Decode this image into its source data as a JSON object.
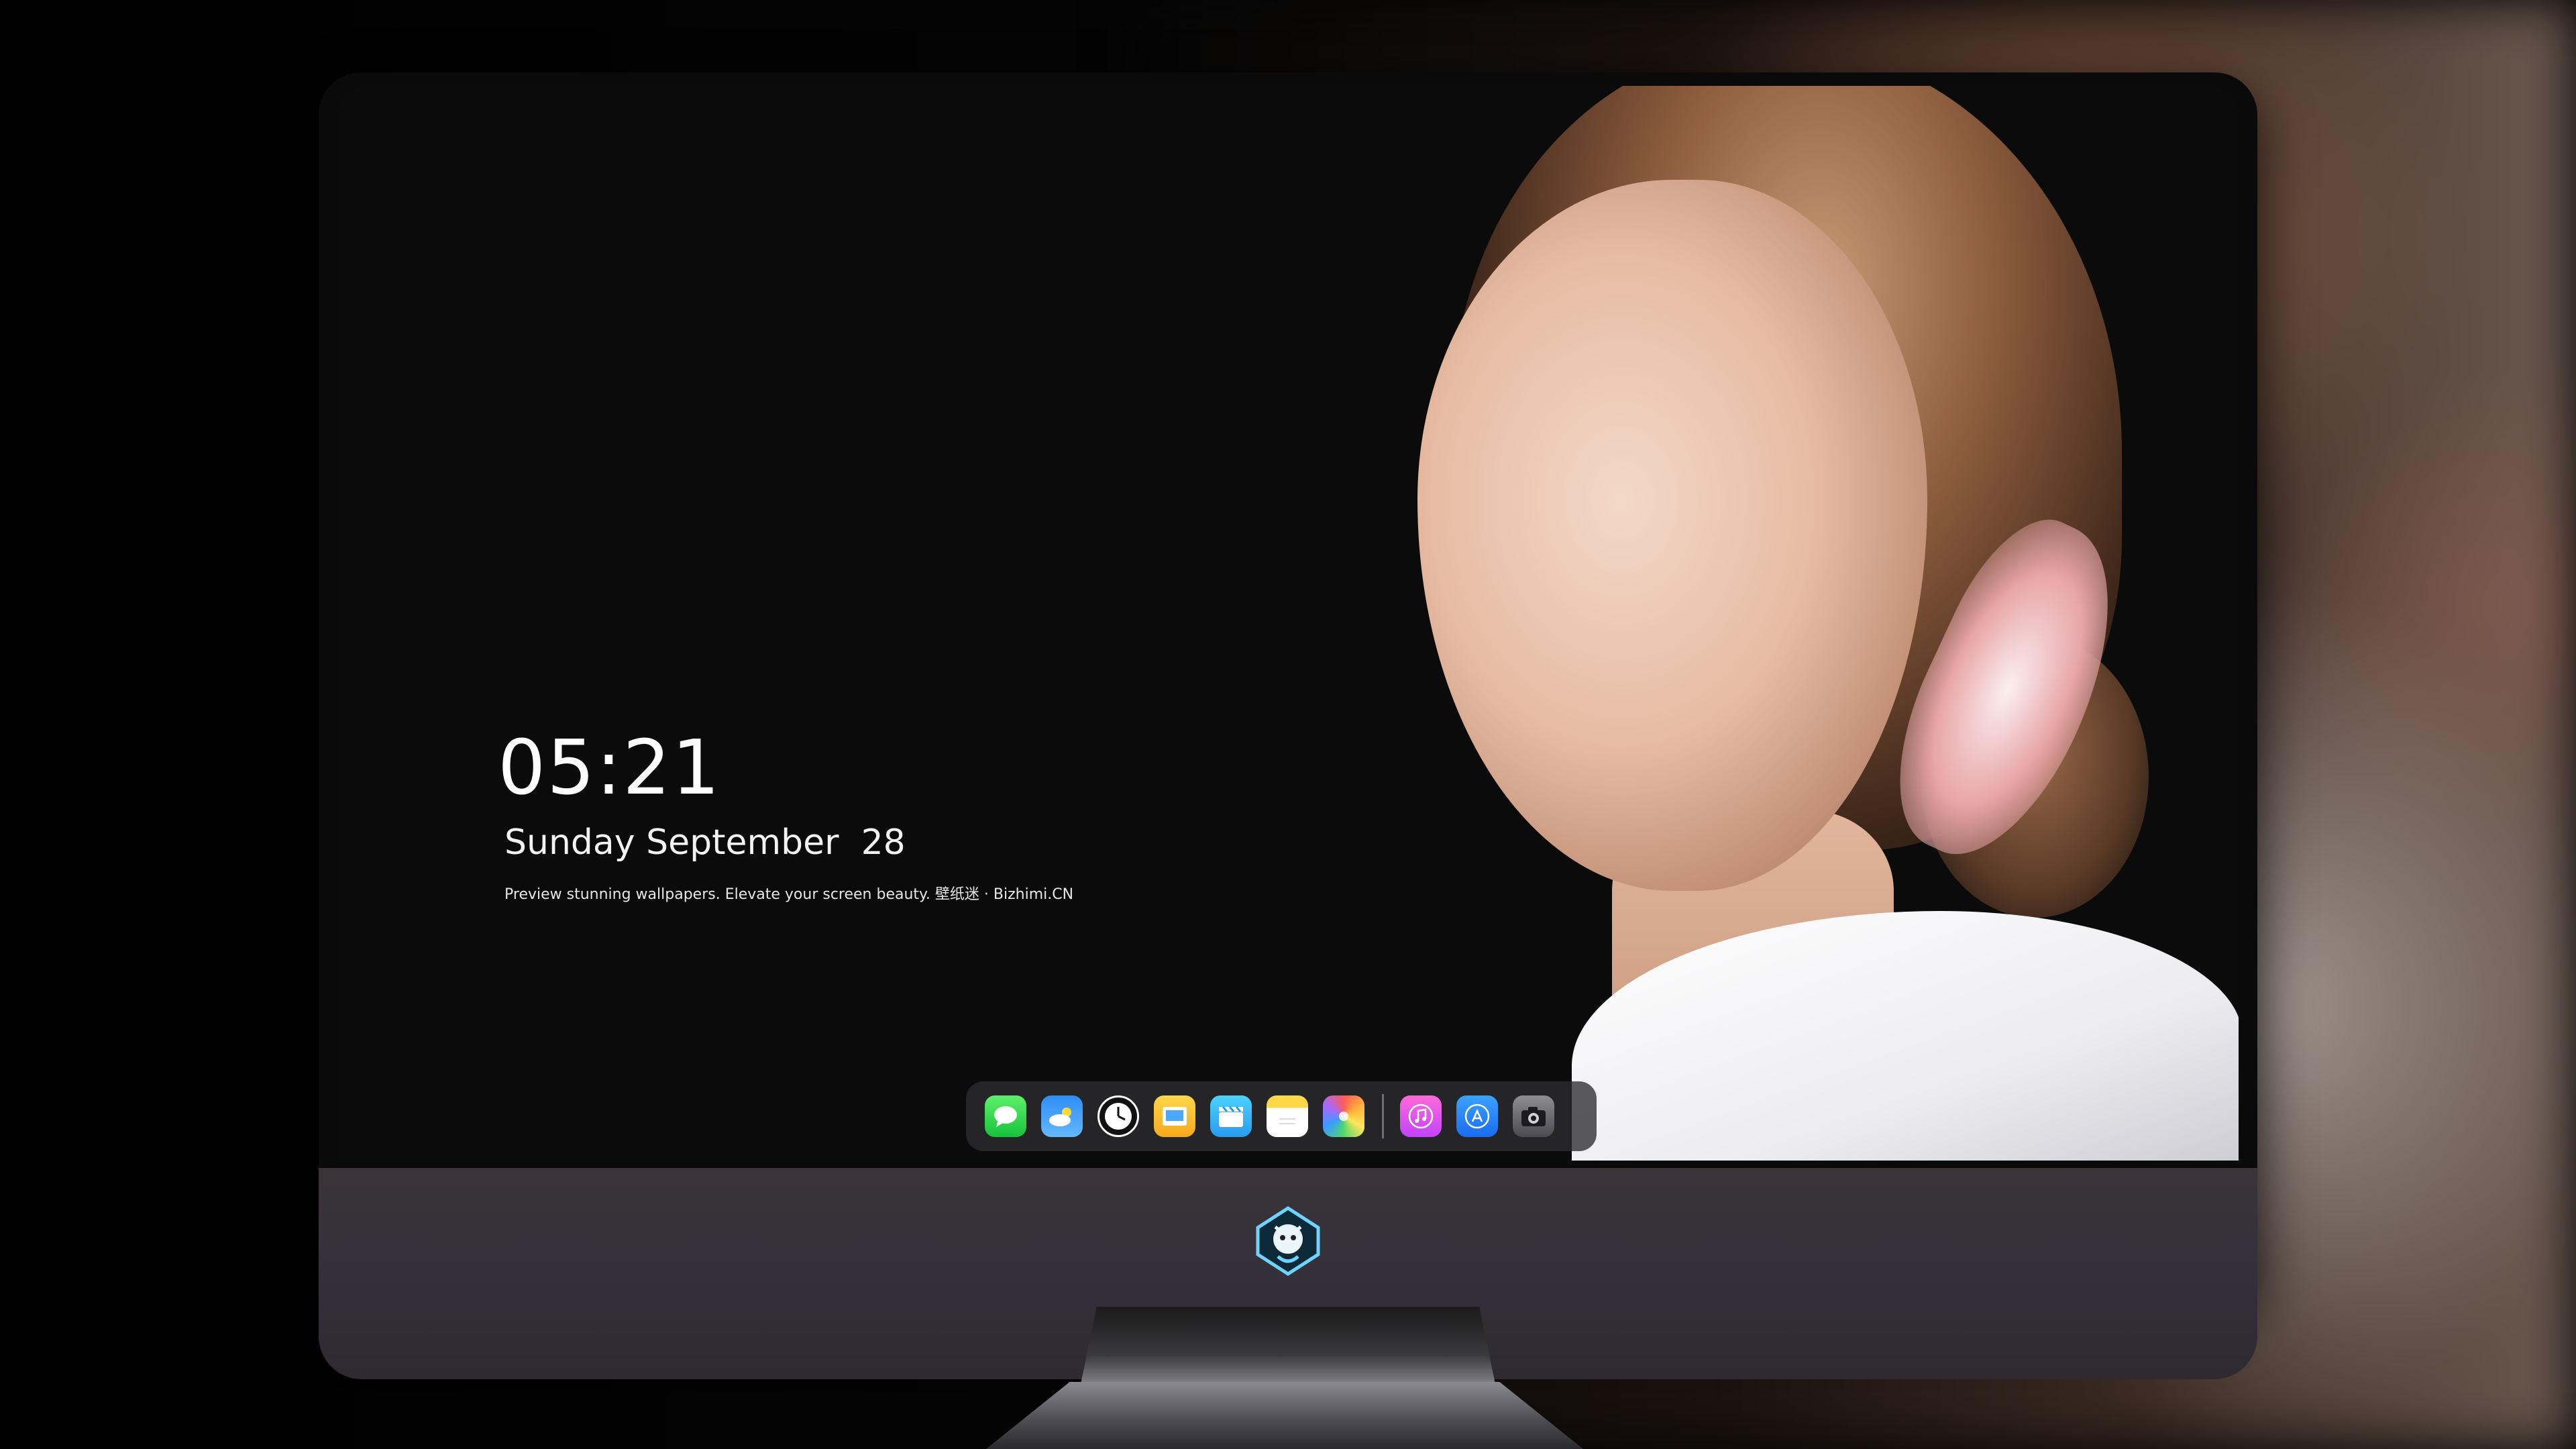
{
  "lockscreen": {
    "time": "05:21",
    "date": "Sunday September  28",
    "tagline": "Preview stunning wallpapers. Elevate your screen beauty. 壁纸迷 · Bizhimi.CN"
  },
  "dock": {
    "apps": [
      {
        "name": "messages",
        "icon": "message-bubble-icon",
        "glyph": "💬"
      },
      {
        "name": "weather",
        "icon": "weather-cloud-icon",
        "glyph": "☁"
      },
      {
        "name": "clock",
        "icon": "clock-icon",
        "glyph": "🕐"
      },
      {
        "name": "preview",
        "icon": "preview-icon",
        "glyph": "▣"
      },
      {
        "name": "clips",
        "icon": "clapperboard-icon",
        "glyph": "🎬"
      },
      {
        "name": "notes",
        "icon": "notes-icon",
        "glyph": ""
      },
      {
        "name": "photos",
        "icon": "photos-icon",
        "glyph": "✿"
      },
      {
        "name": "music",
        "icon": "music-note-icon",
        "glyph": "♫"
      },
      {
        "name": "app-store",
        "icon": "app-store-icon",
        "glyph": "Ⓐ"
      },
      {
        "name": "camera",
        "icon": "camera-icon",
        "glyph": "📷"
      }
    ]
  },
  "colors": {
    "screen_bg": "#0b0b0b",
    "chin": "#34303a",
    "dock_bg": "rgba(45,45,48,0.78)",
    "text": "#ffffff"
  }
}
